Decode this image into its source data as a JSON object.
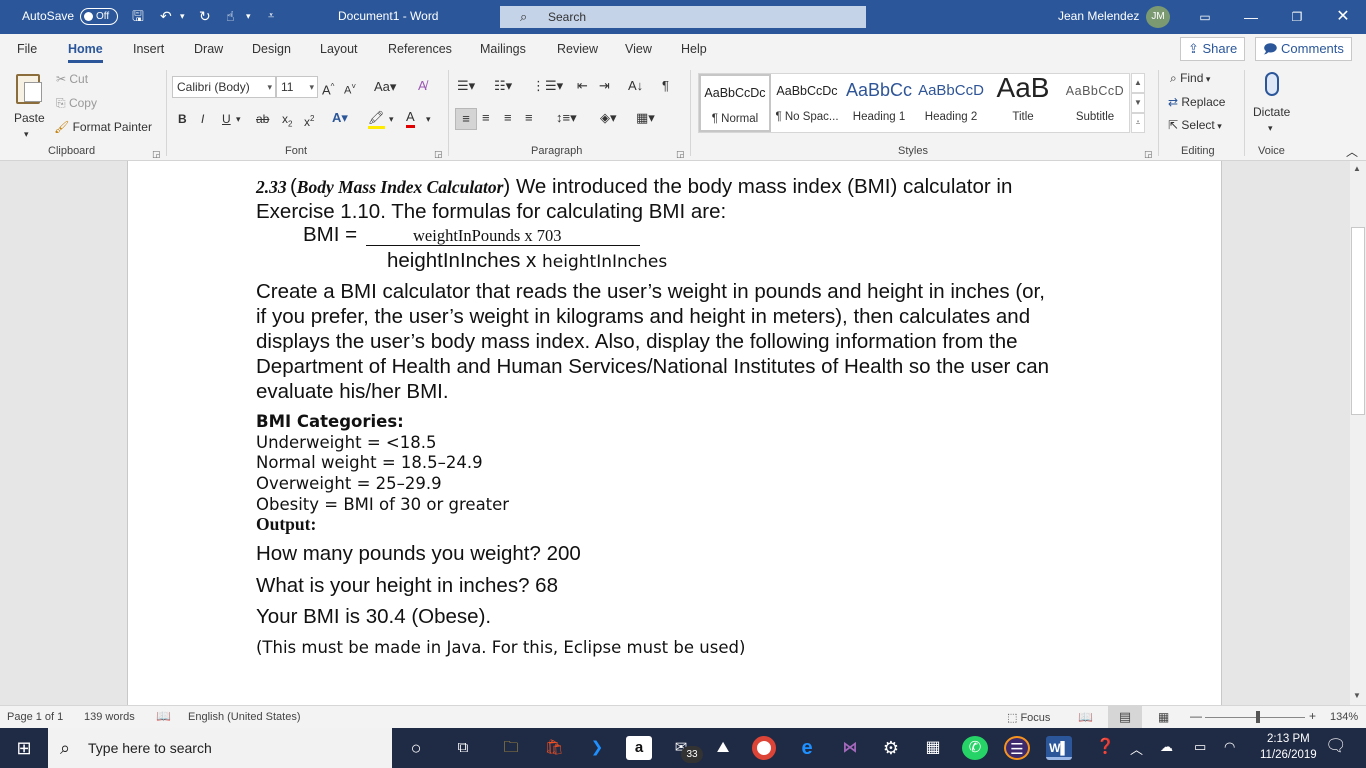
{
  "titlebar": {
    "autosave_label": "AutoSave",
    "autosave_state": "Off",
    "doc_title": "Document1  -  Word",
    "search_placeholder": "Search",
    "user_name": "Jean Melendez",
    "user_initials": "JM"
  },
  "tabs": [
    "File",
    "Home",
    "Insert",
    "Draw",
    "Design",
    "Layout",
    "References",
    "Mailings",
    "Review",
    "View",
    "Help"
  ],
  "share_label": "Share",
  "comments_label": "Comments",
  "clipboard": {
    "paste": "Paste",
    "cut": "Cut",
    "copy": "Copy",
    "format_painter": "Format Painter",
    "group": "Clipboard"
  },
  "font": {
    "name": "Calibri (Body)",
    "size": "11",
    "group": "Font"
  },
  "paragraph": {
    "group": "Paragraph"
  },
  "styles": {
    "group": "Styles",
    "items": [
      {
        "preview": "AaBbCcDc",
        "name": "¶ Normal",
        "color": "#222222"
      },
      {
        "preview": "AaBbCcDc",
        "name": "¶ No Spac...",
        "color": "#222222"
      },
      {
        "preview": "AaBbCc",
        "name": "Heading 1",
        "color": "#2f5597"
      },
      {
        "preview": "AaBbCcD",
        "name": "Heading 2",
        "color": "#2f5597"
      },
      {
        "preview": "AaB",
        "name": "Title",
        "color": "#222222"
      },
      {
        "preview": "AaBbCcD",
        "name": "Subtitle",
        "color": "#595959"
      }
    ]
  },
  "editing": {
    "find": "Find",
    "replace": "Replace",
    "select": "Select",
    "group": "Editing"
  },
  "voice": {
    "dictate": "Dictate",
    "group": "Voice"
  },
  "document": {
    "ex_num": "2.33",
    "ex_title": "Body Mass Index Calculator",
    "intro_rest": " We introduced the body mass index (BMI) calculator in",
    "line2": "Exercise 1.10. The formulas for calculating BMI are:",
    "bmi_label": "BMI =",
    "numerator": "weightInPounds x 703",
    "denom_a": "heightInInches",
    "denom_x": " x ",
    "denom_b": "heightInInches",
    "para": [
      "Create a BMI calculator that reads the user’s weight in pounds and height in inches (or,",
      "if you prefer, the user’s weight in kilograms and height in meters), then calculates and",
      "displays the user’s body mass index. Also, display the following information from the",
      "Department of Health and Human Services/National Institutes of Health so the user can",
      "evaluate his/her BMI."
    ],
    "categories_heading": "BMI Categories:",
    "categories": [
      "Underweight = <18.5",
      "Normal weight = 18.5–24.9",
      "Overweight = 25–29.9",
      "Obesity = BMI of 30 or greater"
    ],
    "output_heading": "Output:",
    "output": [
      "How many pounds you weight? 200",
      "What is your height in inches? 68",
      "Your BMI is 30.4 (Obese)."
    ],
    "note": "(This must be made in Java. For this, Eclipse must be used)"
  },
  "status": {
    "page": "Page 1 of 1",
    "words": "139 words",
    "language": "English (United States)",
    "focus": "Focus",
    "zoom": "134%"
  },
  "taskbar": {
    "search_placeholder": "Type here to search",
    "mail_badge": "33",
    "time": "2:13 PM",
    "date": "11/26/2019"
  }
}
